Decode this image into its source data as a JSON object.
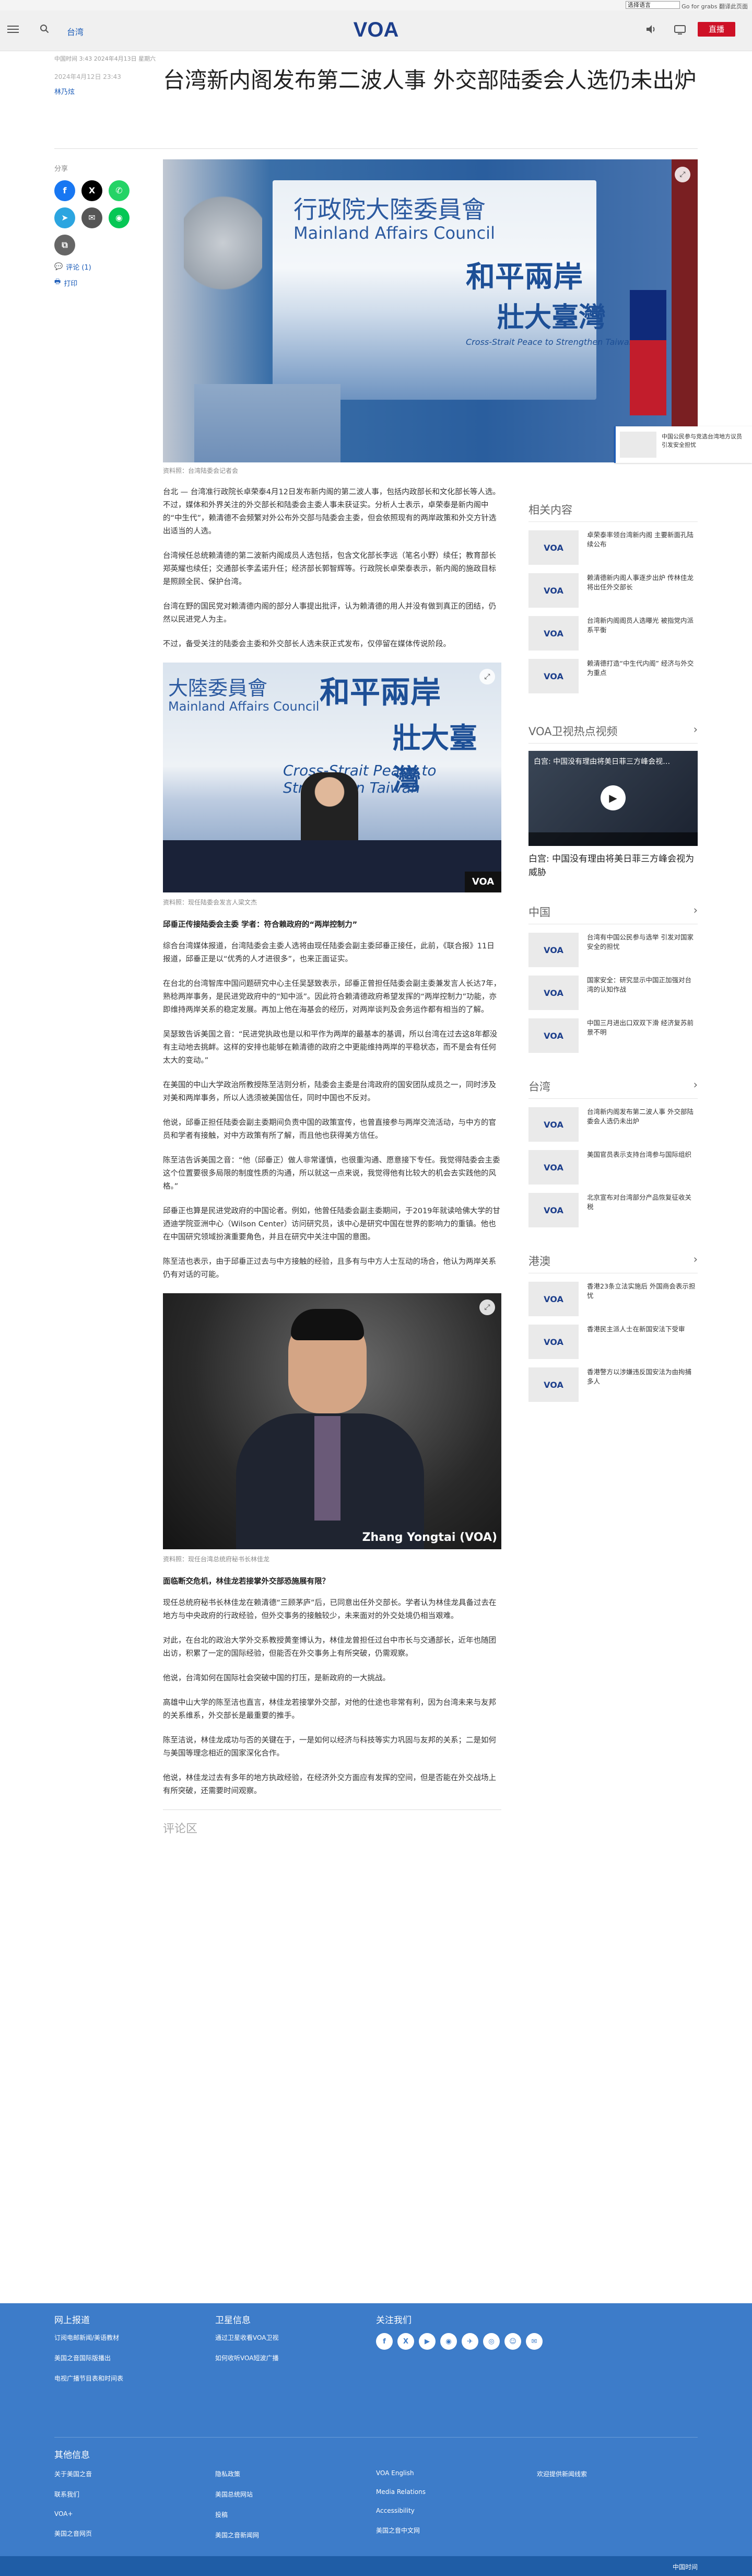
{
  "language_bar": {
    "selector_value": "选择语言",
    "auto_text": "Go for grabs 翻译此页面"
  },
  "header": {
    "section": "台湾",
    "live_label": "直播",
    "logo_text": "VOA"
  },
  "article": {
    "meta_top": "中国时间 3:43 2024年4月13日 星期六",
    "date": "2024年4月12日 23:43",
    "author": "林乃炫",
    "title": "台湾新内阁发布第二波人事 外交部陆委会人选仍未出炉",
    "hero_caption": "资料照：台湾陆委会记者会",
    "hero_texts": {
      "agency": "行政院大陸委員會",
      "agency_en": "Mainland Affairs Council",
      "slogan1": "和平兩岸",
      "slogan2": "壯大臺灣",
      "slogan_en": "Cross-Strait Peace to Strengthen Taiwan"
    },
    "paragraphs_1": [
      "台北 — 台湾准行政院长卓荣泰4月12日发布新内阁的第二波人事，包括内政部长和文化部长等人选。不过，媒体和外界关注的外交部长和陆委会主委人事未获证实。分析人士表示，卓荣泰是新内阁中的“中生代”，赖清德不会频繁对外公布外交部与陆委会主委，但会依照现有的两岸政策和外交方针选出适当的人选。",
      "台湾候任总统赖清德的第二波新内阁成员人选包括，包含文化部长李远（笔名小野）续任；教育部长郑英耀也续任；交通部长李孟诺升任；经济部长郭智辉等。行政院长卓荣泰表示，新内阁的施政目标是照顾全民、保护台湾。",
      "台湾在野的国民党对赖清德内阁的部分人事提出批评，认为赖清德的用人并没有做到真正的团结，仍然以民进党人为主。",
      "不过，备受关注的陆委会主委和外交部长人选未获正式发布，仅停留在媒体传说阶段。"
    ],
    "inline1_caption": "资料照：现任陆委会发言人梁文杰",
    "inline1_texts": {
      "council": "大陸委員會",
      "council_en": "Mainland Affairs Council",
      "slogan1": "和平兩岸",
      "slogan2": "壯大臺灣",
      "slogan_en": "Cross-Strait Peace to Strengthen Taiwan"
    },
    "heading_1": "邱垂正传接陆委会主委 学者：符合赖政府的“两岸控制力”",
    "paragraphs_2": [
      "综合台湾媒体报道，台湾陆委会主委人选将由现任陆委会副主委邱垂正接任，此前，《联合报》11日报道，邱垂正是以“优秀的人才进很多”，也来正面证实。",
      "在台北的台湾智库中国问题研究中心主任吴瑟致表示，邱垂正曾担任陆委会副主委兼发言人长达7年，熟稔两岸事务，是民进党政府中的“知中派”。因此符合赖清德政府希望发挥的“两岸控制力”功能，亦即维持两岸关系的稳定发展。再加上他在海基会的经历，对两岸谈判及会务运作都有相当的了解。",
      "吴瑟致告诉美国之音：“民进党执政也是以和平作为两岸的最基本的基调，所以台湾在过去这8年都没有主动地去挑衅。这样的安排也能够在赖清德的政府之中更能维持两岸的平稳状态，而不是会有任何太大的变动。”",
      "在美国的中山大学政治所教授陈至洁则分析，陆委会主委是台湾政府的国安团队成员之一，同时涉及对美和两岸事务，所以人选须被美国信任，同时中国也不反对。",
      "他说，邱垂正担任陆委会副主委期间负责中国的政策宣传，也曾直接参与两岸交流活动，与中方的官员和学者有接触，对中方政策有所了解，而且他也获得美方信任。",
      "陈至洁告诉美国之音：“他（邱垂正）做人非常谨慎，也很重沟通、愿意接下专任。我觉得陆委会主委这个位置要很多局限的制度性质的沟通，所以就这一点来说，我觉得他有比较大的机会去实践他的风格。”",
      "邱垂正也算是民进党政府的中国论者。例如，他曾任陆委会副主委期间，于2019年就读哈佛大学的甘迺迪学院亚洲中心（Wilson Center）访问研究员，该中心是研究中国在世界的影响力的重镇。他也在中国研究领域扮演重要角色，并且在研究中关注中国的意图。",
      "陈至洁也表示，由于邱垂正过去与中方接触的经验，且多有与中方人士互动的场合，他认为两岸关系仍有对话的可能。"
    ],
    "inline2_caption": "资料照：现任台湾总统府秘书长林佳龙",
    "inline2_watermark": "Zhang Yongtai (VOA)",
    "heading_2": "面临断交危机，林佳龙若接掌外交部恐施展有限？",
    "paragraphs_3": [
      "现任总统府秘书长林佳龙在赖清德“三顾茅庐”后，已同意出任外交部长。学者认为林佳龙具备过去在地方与中央政府的行政经验，但外交事务的接触较少，未来面对的外交处境仍相当艰难。",
      "对此，在台北的政治大学外交系教授黄奎博认为，林佳龙曾担任过台中市长与交通部长，近年也随团出访，积累了一定的国际经验，但能否在外交事务上有所突破，仍需观察。",
      "他说，台湾如何在国际社会突破中国的打压，是新政府的一大挑战。",
      "高雄中山大学的陈至洁也直言，林佳龙若接掌外交部，对他的仕途也非常有利，因为台湾未来与友邦的关系维系，外交部长是最重要的推手。",
      "陈至洁说，林佳龙成功与否的关键在于，一是如何以经济与科技等实力巩固与友邦的关系；二是如何与美国等理念相近的国家深化合作。",
      "他说，林佳龙过去有多年的地方执政经验，在经济外交方面应有发挥的空间，但是否能在外交战场上有所突破，还需要时间观察。"
    ],
    "comments_label": "评论区"
  },
  "share": {
    "label": "分享",
    "comment_link": "评论 (1)",
    "print_link": "打印"
  },
  "pip": {
    "text": "中国公民参与竞选台湾地方议员 引发安全担忧"
  },
  "sidebar": {
    "related": {
      "title": "相关内容",
      "items": [
        "卓荣泰率领台湾新内阁 主要新面孔陆续公布",
        "赖清德新内阁人事逐步出炉 传林佳龙将出任外交部长",
        "台湾新内阁阁员人选曝光 被指党内派系平衡",
        "赖清德打造“中生代内阁” 经济与外交为重点"
      ]
    },
    "video": {
      "title": "VOA卫视热点视频",
      "video_title": "白宫: 中国没有理由将美日菲三方峰会视为威胁"
    },
    "china": {
      "title": "中国",
      "items": [
        "台湾有中国公民参与选举 引发对国家安全的担忧",
        "国家安全：研究显示中国正加强对台湾的认知作战",
        "中国三月进出口双双下滑 经济复苏前景不明"
      ]
    },
    "taiwan": {
      "title": "台湾",
      "items": [
        "台湾新内阁发布第二波人事 外交部陆委会人选仍未出炉",
        "美国官员表示支持台湾参与国际组织",
        "北京宣布对台湾部分产品恢复征收关税"
      ]
    },
    "hongkong": {
      "title": "港澳",
      "items": [
        "香港23条立法实施后 外国商会表示担忧",
        "香港民主派人士在新国安法下受审",
        "香港警方以涉嫌违反国安法为由拘捕多人"
      ]
    }
  },
  "footer": {
    "col1": {
      "title": "网上报道",
      "links": [
        "订阅电邮新闻/美语教材",
        "美国之音国际版播出",
        "电视广播节目表和时间表"
      ]
    },
    "col2": {
      "title": "卫星信息",
      "links": [
        "通过卫星收看VOA卫视",
        "如何收听VOA短波广播"
      ]
    },
    "col3": {
      "title": "关注我们"
    },
    "social": [
      "f",
      "X",
      "▶",
      "◉",
      "✈",
      "◎",
      "☺",
      "✉"
    ],
    "other": {
      "title": "其他信息",
      "links": [
        "关于美国之音",
        "联系我们",
        "VOA+",
        "美国之音网页",
        "隐私政策",
        "美国总统网站",
        "投稿",
        "美国之音新闻网",
        "VOA English",
        "Media Relations",
        "Accessibility",
        "美国之音中文网",
        "欢迎提供新闻线索"
      ]
    },
    "bottom_text": "中国时间"
  },
  "colors": {
    "accent": "#1a5bb8",
    "live": "#ce1126",
    "footer": "#3d7cc9"
  }
}
